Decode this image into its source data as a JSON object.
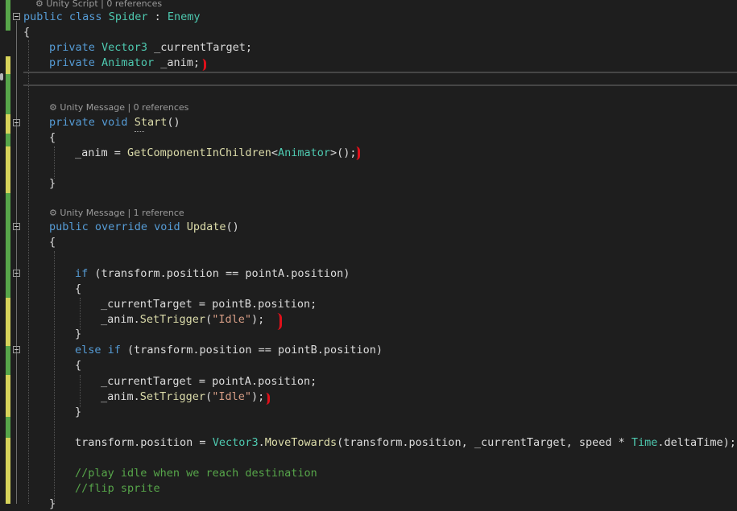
{
  "editor": {
    "codelens": {
      "class_lens": "Unity Script | 0 references",
      "start_lens": "Unity Message | 0 references",
      "update_lens": "Unity Message | 1 reference"
    },
    "tokens": {
      "public_kw": "public",
      "class_kw": "class",
      "class_name": "Spider",
      "colon": " : ",
      "base_class": "Enemy",
      "open_brace": "{",
      "close_brace": "}",
      "private_kw": "private",
      "vector3_type": "Vector3",
      "field_current_target": " _currentTarget;",
      "animator_type": "Animator",
      "field_anim": " _anim;",
      "void_kw": "void",
      "start_method": "Start",
      "parens": "()",
      "anim_assign": "_anim = ",
      "get_component": "GetComponentInChildren",
      "lt": "<",
      "gt_call": ">();",
      "override_kw": "override",
      "update_method": "Update",
      "if_kw": "if",
      "else_kw": "else",
      "cond_a": " (transform.position == pointA.position)",
      "cond_b": " (transform.position == pointB.position)",
      "assign_b": "_currentTarget = pointB.position;",
      "assign_a": "_currentTarget = pointA.position;",
      "anim_prefix": "_anim.",
      "set_trigger": "SetTrigger",
      "open_paren": "(",
      "idle_string": "\"Idle\"",
      "close_call": ");",
      "transform_assign": "transform.position = ",
      "move_towards": "MoveTowards",
      "move_args": "(transform.position, _currentTarget, speed * ",
      "time_type": "Time",
      "delta_time": ".deltaTime);",
      "dot": ".",
      "comment_1": "//play idle when we reach destination",
      "comment_2": "//flip sprite",
      "sp": " "
    }
  }
}
